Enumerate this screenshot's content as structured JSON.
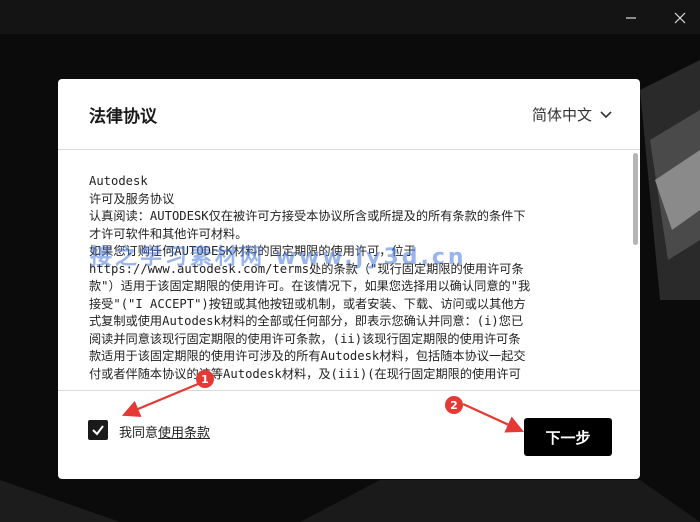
{
  "dialog": {
    "title": "法律协议",
    "language": "简体中文",
    "agreement_lines": [
      "Autodesk",
      "许可及服务协议",
      "认真阅读：AUTODESK仅在被许可方接受本协议所含或所提及的所有条款的条件下",
      "才许可软件和其他许可材料。",
      "如果您订购任何AUTODESK材料的固定期限的使用许可，位于",
      "https://www.autodesk.com/terms处的条款（\"现行固定期限的使用许可条",
      "款\"）适用于该固定期限的使用许可。在该情况下，如果您选择用以确认同意的\"我",
      "接受\"(\"I ACCEPT\")按钮或其他按钮或机制，或者安装、下载、访问或以其他方",
      "式复制或使用Autodesk材料的全部或任何部分，即表示您确认并同意：(i)您已",
      "阅读并同意该现行固定期限的使用许可条款，(ii)该现行固定期限的使用许可条",
      "款适用于该固定期限的使用许可涉及的所有Autodesk材料，包括随本协议一起交",
      "付或者伴随本协议的该等Autodesk材料，及(iii)(在现行固定期限的使用许可"
    ],
    "agree_prefix": "我同意",
    "agree_link": "使用条款",
    "agree_checked": true,
    "next_label": "下一步"
  },
  "annotations": {
    "watermark": "接之学习素材网 www.jy3d.cn",
    "marker_1": "1",
    "marker_2": "2",
    "marker_color": "#e53935"
  },
  "icons": {
    "window_minimize": "minimize-icon",
    "window_close": "close-icon",
    "language_dropdown": "chevron-down-icon",
    "checkbox": "checkmark-icon"
  }
}
